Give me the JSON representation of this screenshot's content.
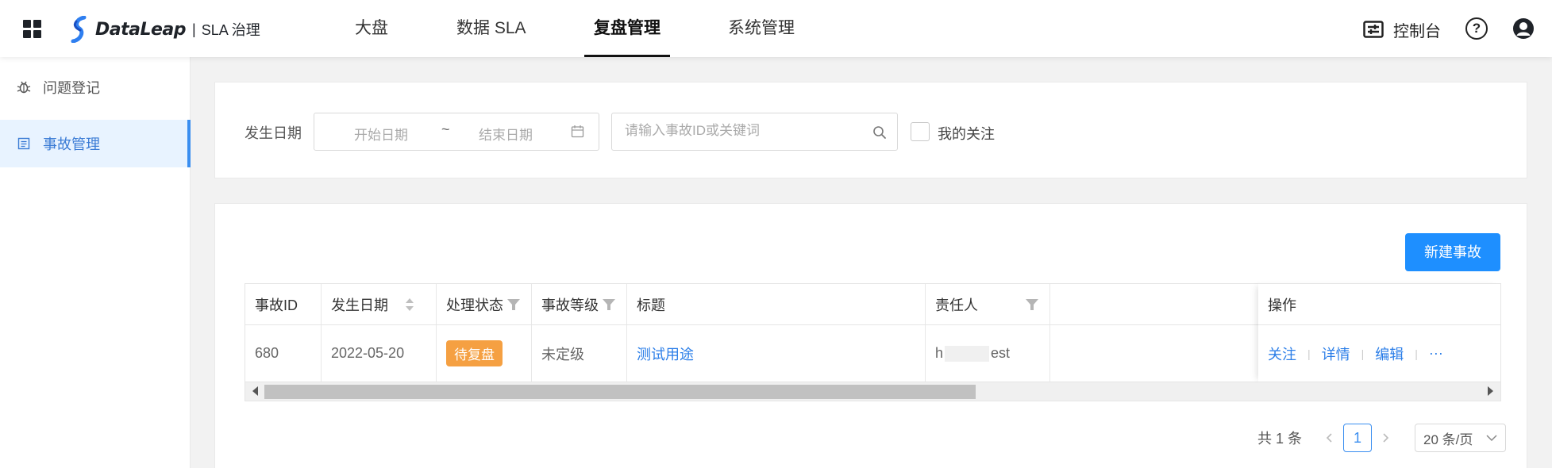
{
  "app": {
    "brand_name": "DataLeap",
    "brand_separator": "|",
    "brand_subtitle": "SLA 治理"
  },
  "nav": {
    "tabs": [
      {
        "label": "大盘",
        "active": false
      },
      {
        "label": "数据 SLA",
        "active": false
      },
      {
        "label": "复盘管理",
        "active": true
      },
      {
        "label": "系统管理",
        "active": false
      }
    ],
    "console_label": "控制台",
    "help_glyph": "?"
  },
  "sidebar": {
    "items": [
      {
        "label": "问题登记",
        "icon": "bug-icon",
        "active": false
      },
      {
        "label": "事故管理",
        "icon": "list-icon",
        "active": true
      }
    ]
  },
  "filter": {
    "date_label": "发生日期",
    "start_placeholder": "开始日期",
    "range_separator": "~",
    "end_placeholder": "结束日期",
    "search_placeholder": "请输入事故ID或关键词",
    "follow_label": "我的关注",
    "follow_checked": false
  },
  "list": {
    "new_button_label": "新建事故",
    "columns": [
      "事故ID",
      "发生日期",
      "处理状态",
      "事故等级",
      "标题",
      "责任人",
      "操作"
    ],
    "rows": [
      {
        "id": "680",
        "date": "2022-05-20",
        "status": "待复盘",
        "level": "未定级",
        "title": "测试用途",
        "owner_prefix": "h",
        "owner_suffix": "est"
      }
    ],
    "actions": [
      "关注",
      "详情",
      "编辑",
      "···"
    ],
    "action_separator": "|"
  },
  "pagination": {
    "total_text": "共 1 条",
    "current_page": "1",
    "page_size": "20 条/页"
  },
  "colors": {
    "primary": "#1e8fff",
    "link": "#2b7ee8",
    "status_pending": "#f5a042",
    "sidebar_active_bg": "#e8f3ff"
  }
}
